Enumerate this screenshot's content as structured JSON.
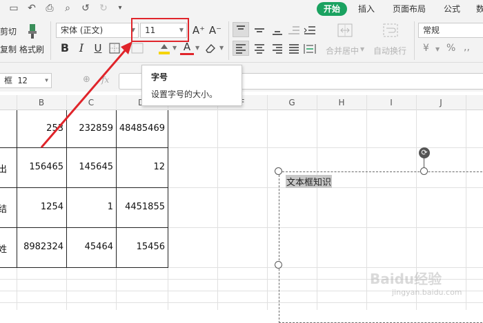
{
  "tabs": {
    "start": "开始",
    "insert": "插入",
    "page_layout": "页面布局",
    "formula": "公式",
    "data_partial": "数"
  },
  "ribbon": {
    "cut_label": "剪切",
    "copy_label": "复制",
    "format_painter_label": "格式刷",
    "font_name": "宋体 (正文)",
    "font_size": "11",
    "increase_font": "A⁺",
    "decrease_font": "A⁻",
    "merge_center_label": "合并居中",
    "auto_wrap_label": "自动换行",
    "number_format": "常规",
    "currency_symbol": "¥",
    "percent_symbol": "%",
    "bold": "B",
    "italic": "I",
    "underline": "U",
    "font_color": "A"
  },
  "tooltip": {
    "title": "字号",
    "description": "设置字号的大小。"
  },
  "formula_bar": {
    "cell_ref": "框 12",
    "fx": "fx"
  },
  "columns": [
    "B",
    "C",
    "D",
    "E",
    "F",
    "G",
    "H",
    "I",
    "J"
  ],
  "table": {
    "row_labels": [
      "",
      "出",
      "结",
      "姓"
    ],
    "rows": [
      [
        "253",
        "232859",
        "48485469"
      ],
      [
        "156465",
        "145645",
        "12"
      ],
      [
        "1254",
        "1",
        "4451855"
      ],
      [
        "8982324",
        "45464",
        "15456"
      ]
    ]
  },
  "textbox": {
    "text": "文本框知识"
  },
  "watermark": {
    "brand": "Baidu经验",
    "url": "jingyan.baidu.com"
  },
  "colors": {
    "accent_green": "#1aa260",
    "highlight_red": "#e0242a",
    "font_color_underline": "#e0242a",
    "fill_yellow": "#f5d400"
  }
}
